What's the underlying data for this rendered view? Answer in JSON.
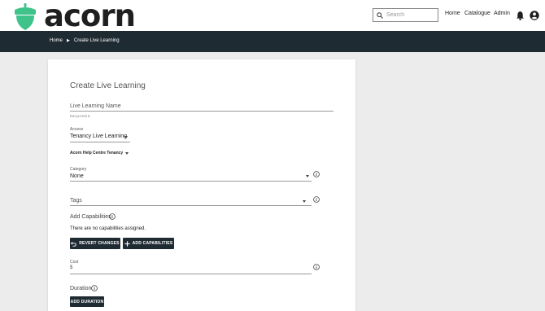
{
  "header": {
    "logo_text": "acorn",
    "search_placeholder": "Search",
    "nav": {
      "home": "Home",
      "catalogue": "Catalogue",
      "admin": "Admin"
    }
  },
  "breadcrumb": {
    "home": "Home",
    "current": "Create Live Learning"
  },
  "form": {
    "title": "Create Live Learning",
    "name_label": "Live Learning Name",
    "name_required": "REQUIRED",
    "access_label": "Access",
    "access_value": "Tenancy Live Learning",
    "tenancy_value": "Acorn Help Centre Tenancy",
    "category_label": "Category",
    "category_value": "None",
    "tags_label": "Tags",
    "capabilities_label": "Add Capabilities",
    "capabilities_note": "There are no capabilities assigned.",
    "revert_button": "REVERT CHANGES",
    "add_capabilities_button": "ADD CAPABILITIES",
    "cost_label": "Cost",
    "cost_prefix": "$",
    "duration_label": "Duration",
    "add_duration_button": "ADD DURATION"
  },
  "colors": {
    "brand_green": "#3ec38a",
    "dark_navy": "#1f2b33",
    "background": "#ececec"
  }
}
